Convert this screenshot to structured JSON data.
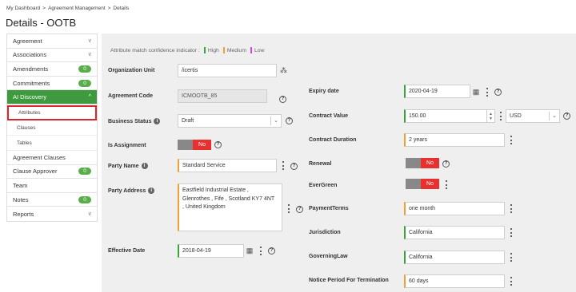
{
  "breadcrumb": {
    "home": "My Dashboard",
    "sep": ">",
    "section": "Agreement Management",
    "current": "Details"
  },
  "page_title": "Details - OOTB",
  "sidebar": {
    "items": [
      {
        "label": "Agreement",
        "chevron": "v"
      },
      {
        "label": "Associations",
        "chevron": "v"
      },
      {
        "label": "Amendments",
        "badge": "0"
      },
      {
        "label": "Commitments",
        "badge": "0"
      },
      {
        "label": "AI Discovery",
        "chevron": "^"
      },
      {
        "label": "Agreement Clauses"
      },
      {
        "label": "Clause Approver",
        "badge": "0"
      },
      {
        "label": "Team"
      },
      {
        "label": "Notes",
        "badge": "0"
      },
      {
        "label": "Reports",
        "chevron": "v"
      }
    ],
    "sub_items": [
      "Attributes",
      "Clauses",
      "Tables"
    ]
  },
  "legend": {
    "text": "Attribute match confidence indicator :",
    "high": "High",
    "medium": "Medium",
    "low": "Low",
    "colors": {
      "high": "#3aa33a",
      "medium": "#f0a030",
      "low": "#e040e0"
    }
  },
  "form_left": {
    "org_unit": {
      "label": "Organization Unit",
      "value": "/icertis"
    },
    "agreement_code": {
      "label": "Agreement Code",
      "value": "ICMOOTB_85"
    },
    "business_status": {
      "label": "Business Status",
      "value": "Draft"
    },
    "is_assignment": {
      "label": "Is Assignment",
      "value": "No"
    },
    "party_name": {
      "label": "Party Name",
      "value": "Standard Service"
    },
    "party_address": {
      "label": "Party Address",
      "lines": [
        "Eastfield Industrial Estate ,",
        "Glenrothes , Fife , Scotland KY7 4NT",
        ", United Kingdom"
      ]
    },
    "effective_date": {
      "label": "Effective Date",
      "value": "2018-04-19"
    }
  },
  "form_right": {
    "expiry_date": {
      "label": "Expiry date",
      "value": "2020-04-19"
    },
    "contract_value": {
      "label": "Contract Value",
      "value": "150.00",
      "currency": "USD"
    },
    "contract_duration": {
      "label": "Contract Duration",
      "value": "2 years"
    },
    "renewal": {
      "label": "Renewal",
      "value": "No"
    },
    "evergreen": {
      "label": "EverGreen",
      "value": "No"
    },
    "payment_terms": {
      "label": "PaymentTerms",
      "value": "one month"
    },
    "jurisdiction": {
      "label": "Jurisdiction",
      "value": "California"
    },
    "governing_law": {
      "label": "GoverningLaw",
      "value": "California"
    },
    "notice_period": {
      "label": "Notice Period For Termination",
      "value": "60 days"
    }
  },
  "icons": {
    "question": "?",
    "calendar": "▦",
    "org_picker": "⁂",
    "info": "i"
  }
}
